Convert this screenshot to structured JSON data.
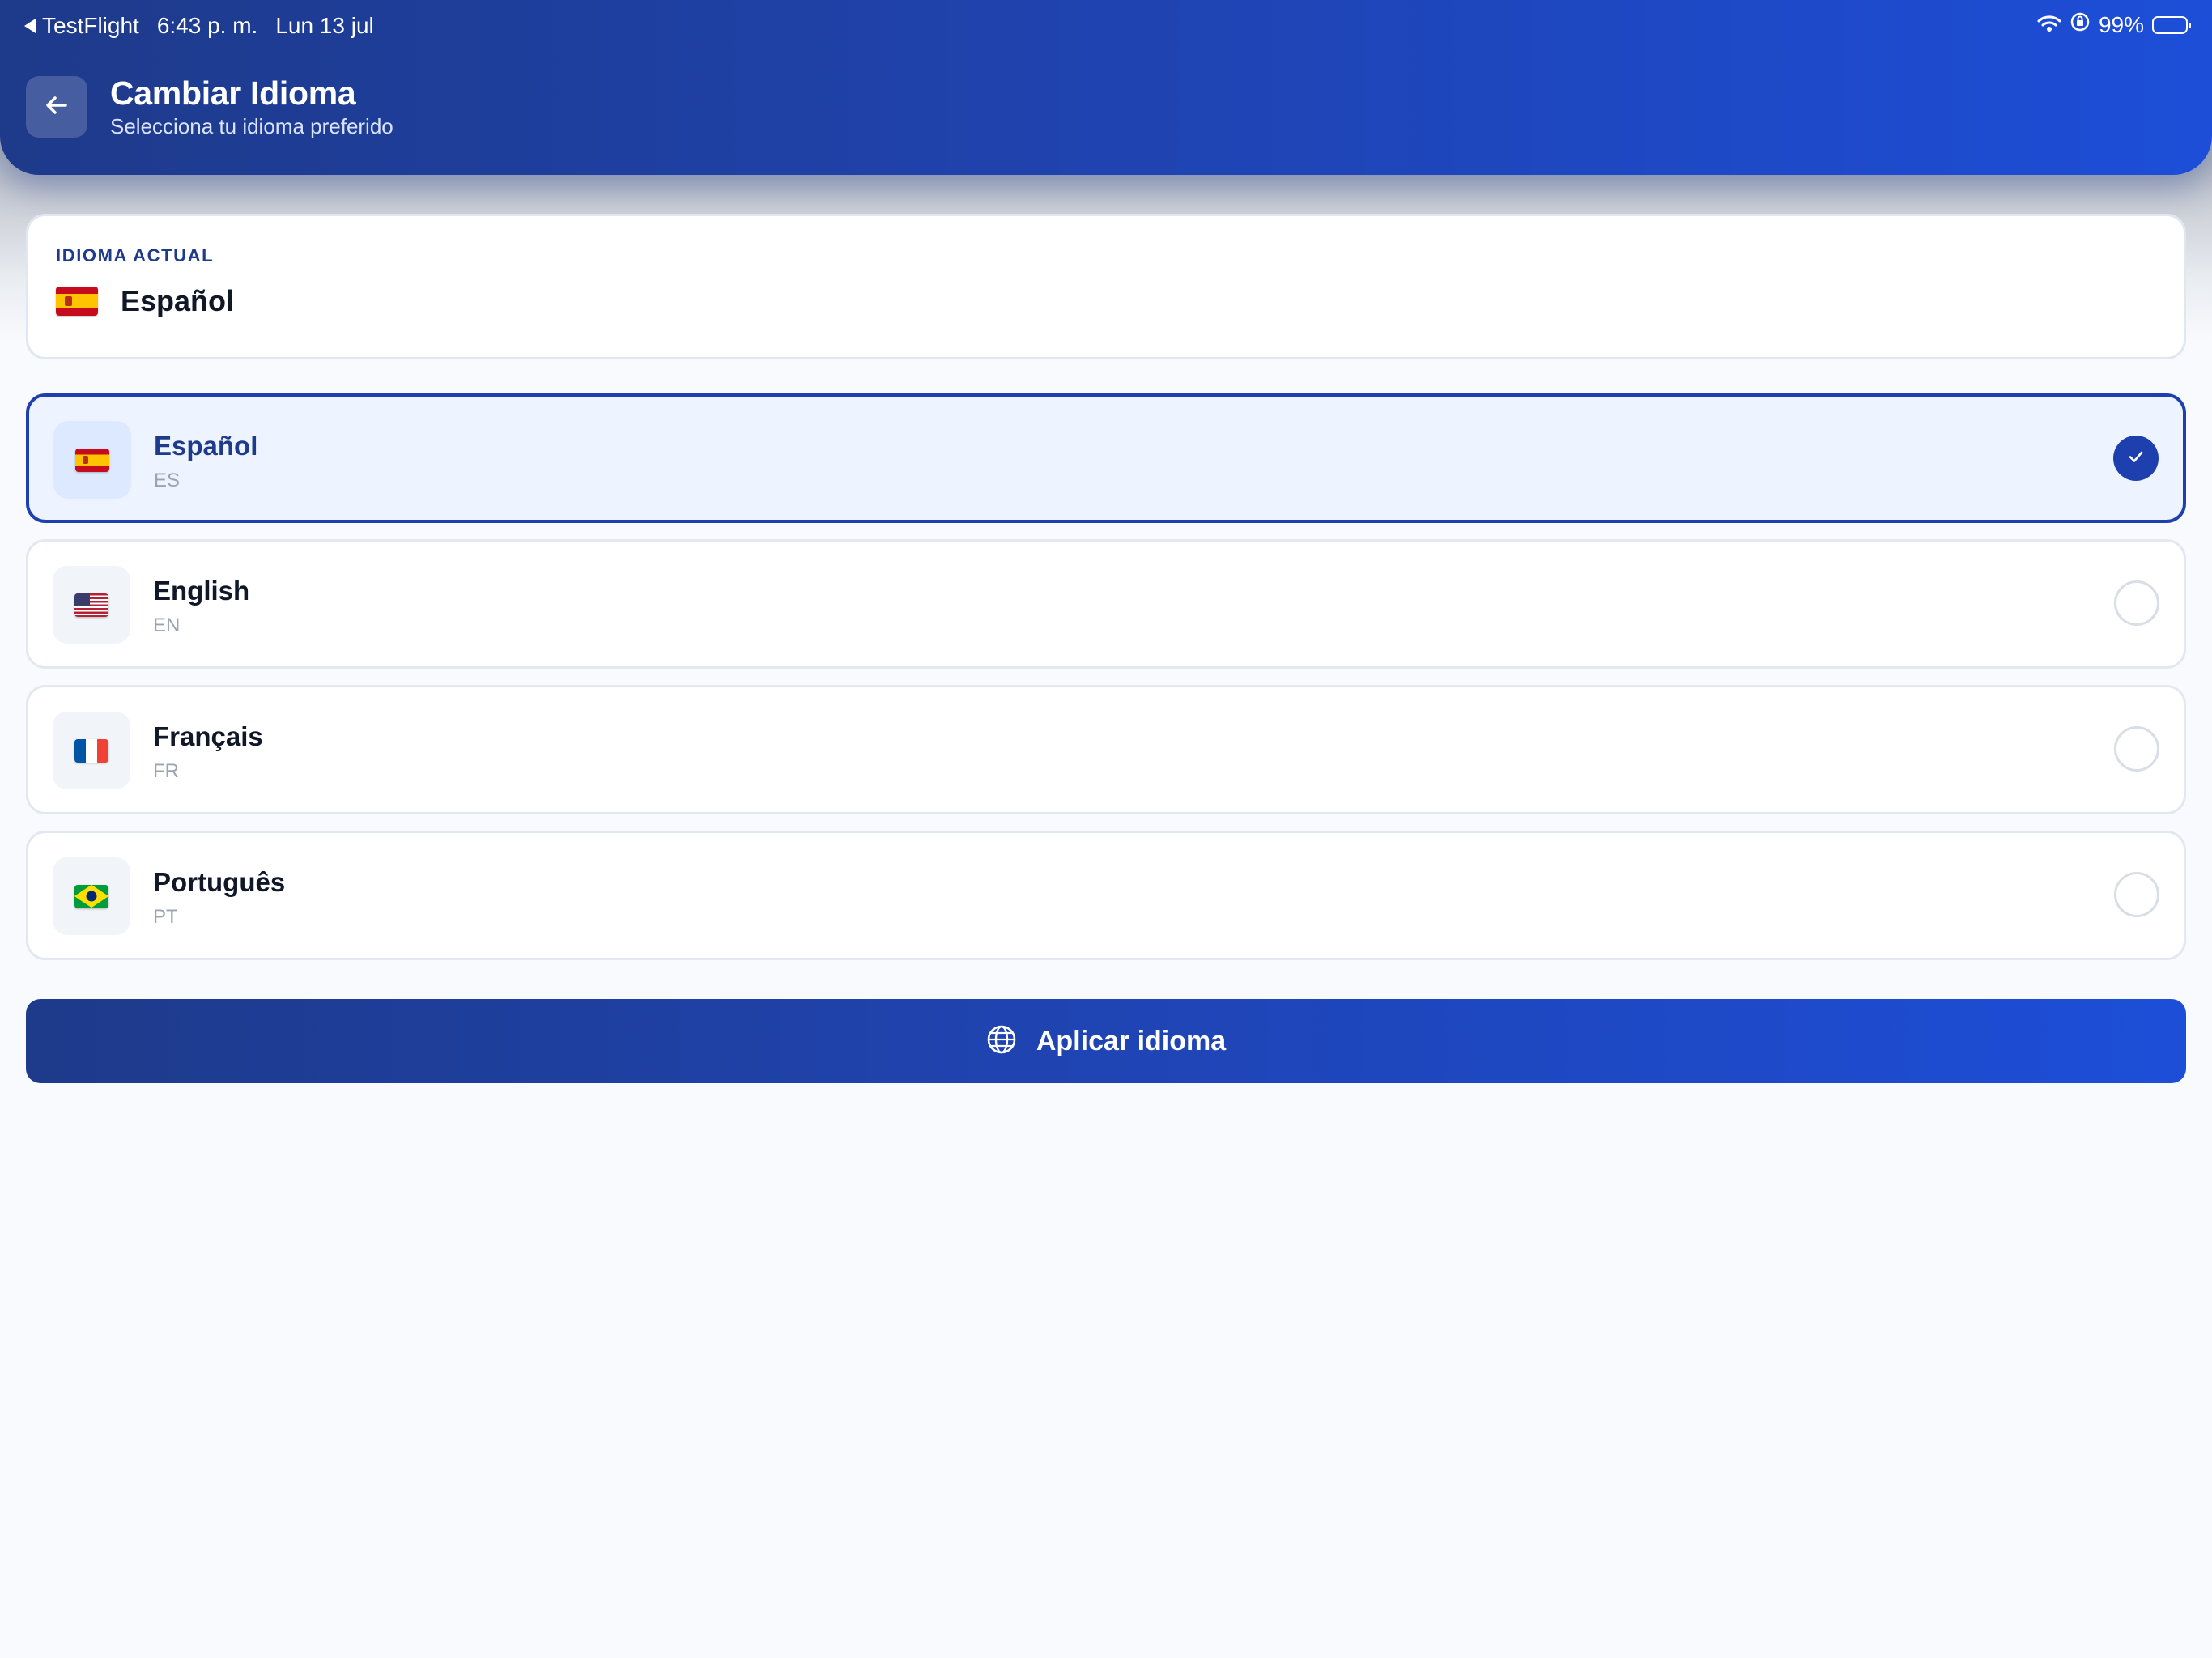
{
  "status_bar": {
    "back_app": "TestFlight",
    "time": "6:43 p. m.",
    "date": "Lun 13 jul",
    "battery": "99%"
  },
  "header": {
    "title": "Cambiar Idioma",
    "subtitle": "Selecciona tu idioma preferido"
  },
  "current": {
    "label": "IDIOMA ACTUAL",
    "name": "Español",
    "flag": "flag-spain-icon"
  },
  "languages": [
    {
      "name": "Español",
      "code": "ES",
      "flag": "flag-spain-icon",
      "selected": true
    },
    {
      "name": "English",
      "code": "EN",
      "flag": "flag-usa-icon",
      "selected": false
    },
    {
      "name": "Français",
      "code": "FR",
      "flag": "flag-france-icon",
      "selected": false
    },
    {
      "name": "Português",
      "code": "PT",
      "flag": "flag-brazil-icon",
      "selected": false
    }
  ],
  "apply_button": {
    "label": "Aplicar idioma",
    "icon": "globe-icon"
  },
  "colors": {
    "brand_dark": "#1e3a8a",
    "brand_bright": "#1d4ed8",
    "selected_bg": "#edf4ff",
    "selected_border": "#1e40af",
    "background": "#f8fafd"
  }
}
